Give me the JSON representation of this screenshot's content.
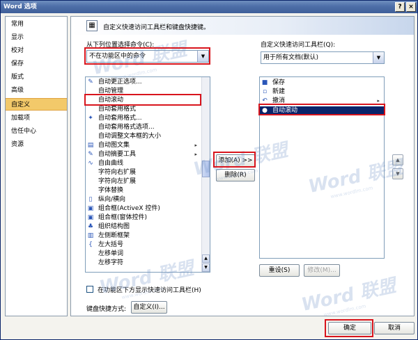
{
  "window": {
    "title": "Word 选项",
    "help_glyph": "?",
    "close_glyph": "×"
  },
  "sidebar": {
    "items": [
      {
        "label": "常用"
      },
      {
        "label": "显示"
      },
      {
        "label": "校对"
      },
      {
        "label": "保存"
      },
      {
        "label": "版式"
      },
      {
        "label": "高级"
      },
      {
        "label": "自定义"
      },
      {
        "label": "加载项"
      },
      {
        "label": "信任中心"
      },
      {
        "label": "资源"
      }
    ],
    "active_index": 6
  },
  "header": {
    "title": "自定义快速访问工具栏和键盘快捷键。"
  },
  "left_panel": {
    "label": "从下列位置选择命令(C):",
    "combo_value": "不在功能区中的命令",
    "commands": [
      {
        "label": "自动更正选项...",
        "icon": "autocorrect-icon"
      },
      {
        "label": "自动管理",
        "icon": ""
      },
      {
        "label": "自动滚动",
        "icon": ""
      },
      {
        "label": "自动套用格式",
        "icon": ""
      },
      {
        "label": "自动套用格式...",
        "icon": "autoformat-icon"
      },
      {
        "label": "自动套用格式选项...",
        "icon": ""
      },
      {
        "label": "自动调整文本框的大小",
        "icon": ""
      },
      {
        "label": "自动图文集",
        "icon": "autotext-icon",
        "submenu": "▸"
      },
      {
        "label": "自动摘要工具",
        "icon": "autosummary-icon",
        "submenu": "▸"
      },
      {
        "label": "自由曲线",
        "icon": "freeform-icon"
      },
      {
        "label": "字符向右扩展",
        "icon": ""
      },
      {
        "label": "字符向左扩展",
        "icon": ""
      },
      {
        "label": "字体替换",
        "icon": ""
      },
      {
        "label": "纵向/横向",
        "icon": "orientation-icon"
      },
      {
        "label": "组合框(ActiveX 控件)",
        "icon": "combobox-icon"
      },
      {
        "label": "组合框(窗体控件)",
        "icon": "combobox-form-icon"
      },
      {
        "label": "组织结构图",
        "icon": "orgchart-icon"
      },
      {
        "label": "左侧断框架",
        "icon": "frame-icon"
      },
      {
        "label": "左大括号",
        "icon": "brace-icon"
      },
      {
        "label": "左移单词",
        "icon": ""
      },
      {
        "label": "左移字符",
        "icon": ""
      }
    ],
    "checkbox_label": "在功能区下方显示快速访问工具栏(H)",
    "shortcut_label": "键盘快捷方式:",
    "customize_button": "自定义(I)..."
  },
  "middle": {
    "add_button": "添加(A) >>",
    "remove_button": "删除(R)"
  },
  "right_panel": {
    "label": "自定义快速访问工具栏(Q):",
    "combo_value": "用于所有文档(默认)",
    "items": [
      {
        "label": "保存",
        "icon": "save-icon"
      },
      {
        "label": "新建",
        "icon": "new-document-icon"
      },
      {
        "label": "撤消",
        "icon": "undo-icon",
        "submenu": "▸"
      },
      {
        "label": "自动滚动",
        "icon": "autoscroll-icon"
      }
    ],
    "selected_index": 3,
    "reset_button": "重设(S)",
    "modify_button": "修改(M)..."
  },
  "footer": {
    "ok_button": "确定",
    "cancel_button": "取消"
  },
  "watermark": {
    "text": "Word 联盟",
    "url": "www.wordlm.com"
  },
  "colors": {
    "highlight_red": "#d8141c",
    "selection_blue": "#0a246a",
    "sidebar_active": "#f3c96a"
  }
}
